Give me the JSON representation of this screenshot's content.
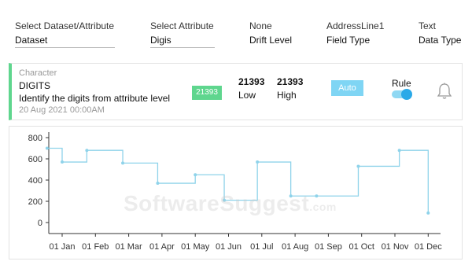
{
  "filters": [
    {
      "label": "Select Dataset/Attribute",
      "value": "Dataset"
    },
    {
      "label": "Select Attribute",
      "value": "Digis"
    },
    {
      "label": "None",
      "value": "Drift Level"
    },
    {
      "label": "AddressLine1",
      "value": "Field Type"
    },
    {
      "label": "Text",
      "value": "Data Type"
    }
  ],
  "rule_card": {
    "category": "Character",
    "name": "DIGITS",
    "description": "Identify the digits from attribute level",
    "date": "20 Aug 2021 00:00AM",
    "badge": "21393",
    "low_value": "21393",
    "low_label": "Low",
    "high_value": "21393",
    "high_label": "High",
    "auto_label": "Auto",
    "rule_label": "Rule",
    "rule_enabled": true,
    "accent_color": "#5fd68e"
  },
  "watermark": {
    "main": "SoftwareSuggest",
    "suffix": ".com"
  },
  "chart_data": {
    "type": "line",
    "step": true,
    "color": "#8fd3ea",
    "ylim": [
      0,
      800
    ],
    "yticks": [
      "0",
      "200",
      "400",
      "600",
      "800"
    ],
    "xticks": [
      "01 Jan",
      "01 Feb",
      "01 Mar",
      "01 Apr",
      "01 May",
      "01 Jun",
      "01 Jul",
      "01 Aug",
      "01 Sep",
      "01 Oct",
      "01 Nov",
      "01 Dec"
    ],
    "points": [
      {
        "x": "2021-12-18",
        "y": 700
      },
      {
        "x": "2022-01-01",
        "y": 570
      },
      {
        "x": "2022-01-24",
        "y": 680
      },
      {
        "x": "2022-02-24",
        "y": 560
      },
      {
        "x": "2022-03-28",
        "y": 370
      },
      {
        "x": "2022-05-01",
        "y": 450
      },
      {
        "x": "2022-05-28",
        "y": 210
      },
      {
        "x": "2022-06-27",
        "y": 570
      },
      {
        "x": "2022-07-28",
        "y": 250
      },
      {
        "x": "2022-08-21",
        "y": 250
      },
      {
        "x": "2022-09-28",
        "y": 530
      },
      {
        "x": "2022-11-05",
        "y": 680
      },
      {
        "x": "2022-12-01",
        "y": 90
      }
    ],
    "grid": false
  }
}
